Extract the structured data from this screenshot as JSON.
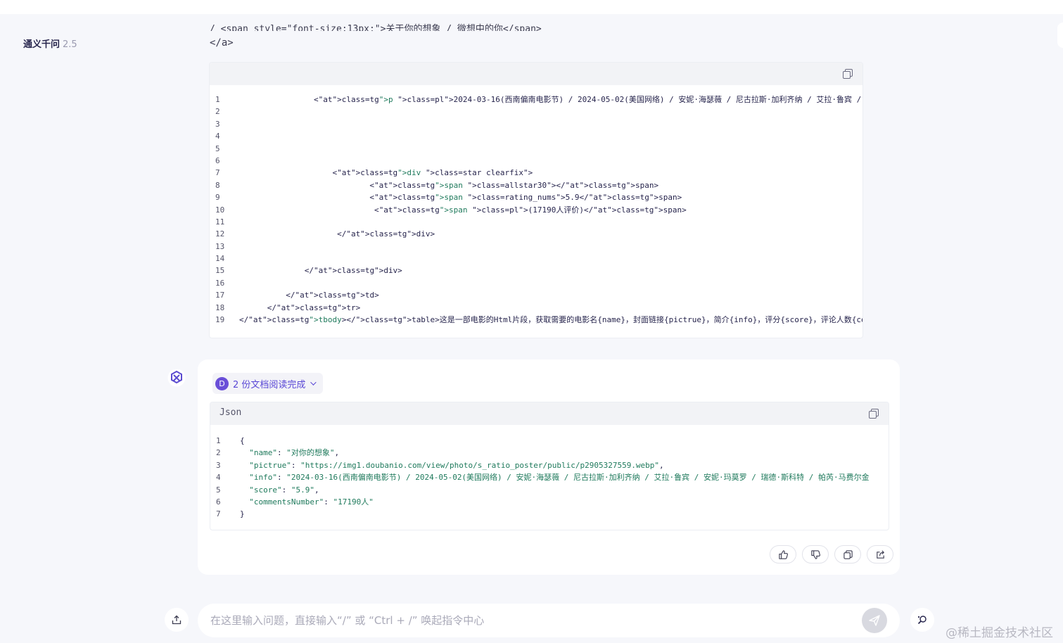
{
  "app": {
    "name": "通义千问",
    "version": "2.5"
  },
  "prev_message": {
    "cut_line": "/ <span style=\"font-size:13px;\">关于你的想象 / 微想中的你</span>",
    "closing_tag": "</a>"
  },
  "html_code": {
    "lines": [
      {
        "n": "1",
        "text": "                <p class=\"pl\">2024-03-16(西南偏南电影节) / 2024-05-02(美国网络) / 安妮·海瑟薇 / 尼古拉斯·加利齐纳 / 艾拉·鲁宾 / 安妮·玛莫罗 /"
      },
      {
        "n": "2",
        "text": ""
      },
      {
        "n": "3",
        "text": ""
      },
      {
        "n": "4",
        "text": ""
      },
      {
        "n": "5",
        "text": ""
      },
      {
        "n": "6",
        "text": ""
      },
      {
        "n": "7",
        "text": "                    <div class=\"star clearfix\">"
      },
      {
        "n": "8",
        "text": "                            <span class=\"allstar30\"></span>"
      },
      {
        "n": "9",
        "text": "                            <span class=\"rating_nums\">5.9</span>"
      },
      {
        "n": "10",
        "text": "                             <span class=\"pl\">(17190人评价)</span>"
      },
      {
        "n": "11",
        "text": ""
      },
      {
        "n": "12",
        "text": "                     </div>"
      },
      {
        "n": "13",
        "text": ""
      },
      {
        "n": "14",
        "text": ""
      },
      {
        "n": "15",
        "text": "              </div>"
      },
      {
        "n": "16",
        "text": ""
      },
      {
        "n": "17",
        "text": "          </td>"
      },
      {
        "n": "18",
        "text": "      </tr>"
      },
      {
        "n": "19",
        "text": "</tbody></table>这是一部电影的Html片段，获取需要的电影名{name}，封面链接{pictrue}，简介{info}，评分{score}，评论人数{commentsNumber}，请使用括"
      }
    ]
  },
  "answer": {
    "doc_badge": "D",
    "doc_status": "2 份文档阅读完成",
    "json_lang": "Json",
    "json_lines": [
      {
        "n": "1",
        "text": "{"
      },
      {
        "n": "2",
        "text": "  \"name\": \"对你的想象\","
      },
      {
        "n": "3",
        "text": "  \"pictrue\": \"https://img1.doubanio.com/view/photo/s_ratio_poster/public/p2905327559.webp\","
      },
      {
        "n": "4",
        "text": "  \"info\": \"2024-03-16(西南偏南电影节) / 2024-05-02(美国网络) / 安妮·海瑟薇 / 尼古拉斯·加利齐纳 / 艾拉·鲁宾 / 安妮·玛莫罗 / 瑞德·斯科特 / 帕芮·马费尔金"
      },
      {
        "n": "5",
        "text": "  \"score\": \"5.9\","
      },
      {
        "n": "6",
        "text": "  \"commentsNumber\": \"17190人\""
      },
      {
        "n": "7",
        "text": "}"
      }
    ],
    "actions": [
      {
        "name": "like-button",
        "icon": "thumbs-up-icon"
      },
      {
        "name": "dislike-button",
        "icon": "thumbs-down-icon"
      },
      {
        "name": "copy-answer-button",
        "icon": "copy-icon"
      },
      {
        "name": "share-button",
        "icon": "share-icon"
      }
    ]
  },
  "input": {
    "placeholder": "在这里输入问题，直接输入“/” 或 “Ctrl + /” 唤起指令中心",
    "value": ""
  },
  "watermark": "@稀土掘金技术社区",
  "colors": {
    "accent": "#6a4fd8",
    "tag": "#7a2fa5",
    "attr": "#b0328c",
    "string": "#1f7a5c"
  }
}
